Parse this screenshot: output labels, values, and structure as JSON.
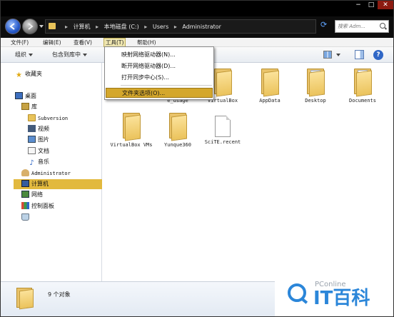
{
  "window": {
    "controls": {
      "minimize": "−",
      "maximize": "□",
      "close": "✕"
    },
    "breadcrumbs": [
      "计算机",
      "本地磁盘 (C:)",
      "Users",
      "Administrator"
    ],
    "search_placeholder": "搜索 Adm..."
  },
  "menubar": [
    "文件(F)",
    "编辑(E)",
    "查看(V)",
    "工具(T)",
    "帮助(H)"
  ],
  "toolbar": {
    "organize": "组织",
    "include_in_library": "包含到库中"
  },
  "tools_menu": {
    "items": [
      "映射网络驱动器(N)...",
      "断开网络驱动器(D)...",
      "打开同步中心(S)...",
      "文件夹选项(O)..."
    ]
  },
  "nav": {
    "favorites": "收藏夹",
    "desktop": "桌面",
    "libraries": "库",
    "subversion": "Subversion",
    "videos": "视频",
    "pictures": "图片",
    "documents": "文档",
    "music": "音乐",
    "administrator": "Administrator",
    "computer": "计算机",
    "network": "网络",
    "control_panel": "控制面板"
  },
  "files": [
    {
      "name": "e_usage",
      "kind": "folder"
    },
    {
      "name": "VirtualBox",
      "kind": "folder"
    },
    {
      "name": "AppData",
      "kind": "folder"
    },
    {
      "name": "Desktop",
      "kind": "folder"
    },
    {
      "name": "Documents",
      "kind": "folder"
    },
    {
      "name": "VirtualBox VMs",
      "kind": "folder"
    },
    {
      "name": "Yunque360",
      "kind": "folder"
    },
    {
      "name": "SciTE.recent",
      "kind": "file"
    }
  ],
  "status": {
    "item_count": "9 个对象"
  },
  "watermark": {
    "brand": "PConline",
    "cn": "IT百科"
  }
}
